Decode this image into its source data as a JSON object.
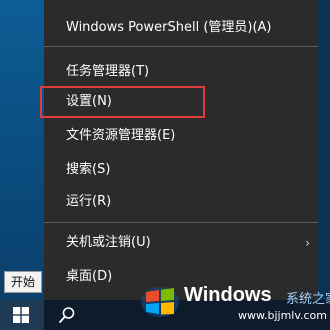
{
  "menu": {
    "items": [
      {
        "label": "Windows PowerShell (管理员)(A)"
      },
      {
        "label": "任务管理器(T)"
      },
      {
        "label": "设置(N)"
      },
      {
        "label": "文件资源管理器(E)"
      },
      {
        "label": "搜索(S)"
      },
      {
        "label": "运行(R)"
      },
      {
        "label": "关机或注销(U)"
      },
      {
        "label": "桌面(D)"
      }
    ],
    "submenu_arrow": "›"
  },
  "taskbar": {
    "start_tooltip": "开始"
  },
  "watermark": {
    "title": "Windows",
    "subtitle": "系统之家",
    "url": "www.bjjmlv.com"
  },
  "colors": {
    "menu_bg": "#2b2b2b",
    "highlight_border": "#e03c3c",
    "taskbar_bg": "#0d1b2a"
  },
  "icons": {
    "start": "windows-logo-icon",
    "search": "search-icon",
    "submenu": "chevron-right-icon"
  }
}
